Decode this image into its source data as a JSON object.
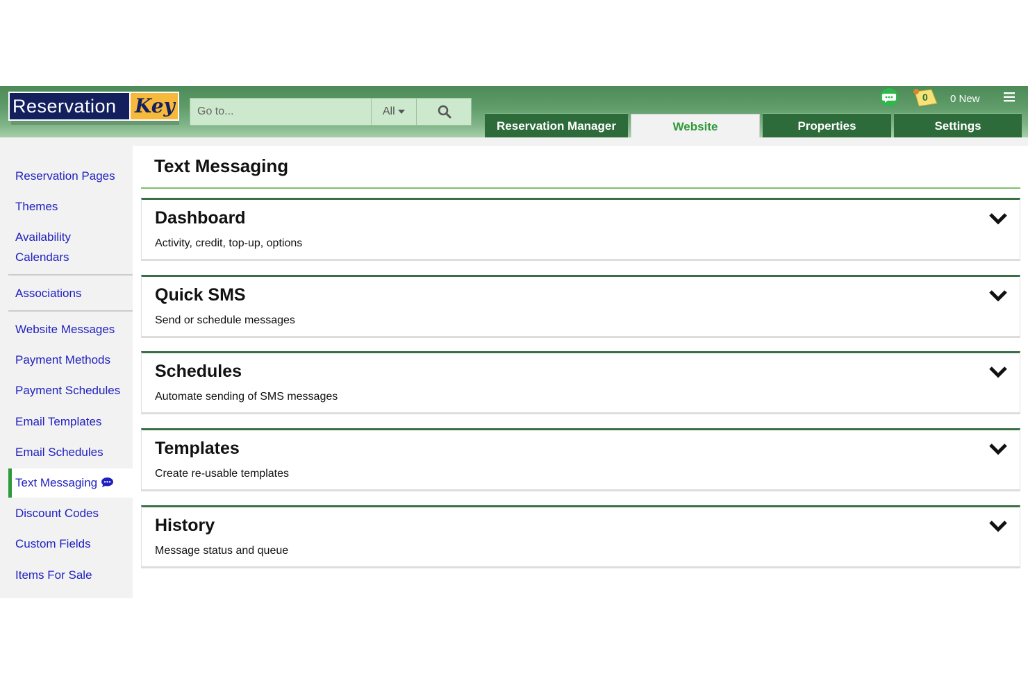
{
  "logo": {
    "part1": "Reservation",
    "part2": "Key"
  },
  "search": {
    "placeholder": "Go to...",
    "scope": "All"
  },
  "tabs": [
    {
      "label": "Reservation Manager"
    },
    {
      "label": "Website"
    },
    {
      "label": "Properties"
    },
    {
      "label": "Settings"
    }
  ],
  "header": {
    "notification_count": "0",
    "new_label": "0 New"
  },
  "sidebar": {
    "items": [
      {
        "label": "Reservation Pages"
      },
      {
        "label": "Themes"
      },
      {
        "label": "Availability"
      },
      {
        "label": "Calendars"
      },
      {
        "label": "Associations"
      },
      {
        "label": "Website Messages"
      },
      {
        "label": "Payment Methods"
      },
      {
        "label": "Payment Schedules"
      },
      {
        "label": "Email Templates"
      },
      {
        "label": "Email Schedules"
      },
      {
        "label": "Text Messaging"
      },
      {
        "label": "Discount Codes"
      },
      {
        "label": "Custom Fields"
      },
      {
        "label": "Items For Sale"
      }
    ]
  },
  "main": {
    "title": "Text Messaging",
    "cards": [
      {
        "title": "Dashboard",
        "subtitle": "Activity, credit, top-up, options"
      },
      {
        "title": "Quick SMS",
        "subtitle": "Send or schedule messages"
      },
      {
        "title": "Schedules",
        "subtitle": "Automate sending of SMS messages"
      },
      {
        "title": "Templates",
        "subtitle": "Create re-usable templates"
      },
      {
        "title": "History",
        "subtitle": "Message status and queue"
      }
    ]
  },
  "colors": {
    "accent": "#2f9a3a",
    "header_dark": "#2e6b3a",
    "link": "#2020c0"
  },
  "icons": [
    "search-icon",
    "chevron-down-icon",
    "chat-icon",
    "bell-icon",
    "menu-icon"
  ]
}
